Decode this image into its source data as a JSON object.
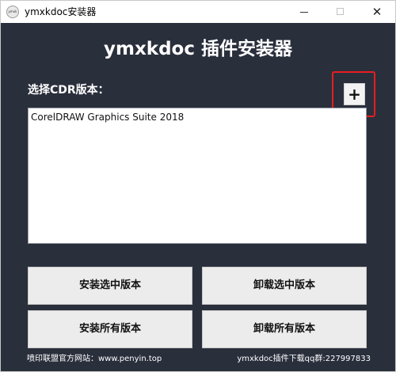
{
  "window": {
    "title": "ymxkdoc安装器",
    "icon_text": "ymxk",
    "minimize_icon": "minimize-icon",
    "maximize_icon": "maximize-icon",
    "close_icon": "close-icon",
    "close_glyph": "✕"
  },
  "main": {
    "title": "ymxkdoc 插件安装器",
    "select_label": "选择CDR版本：",
    "add_button_label": "+",
    "versions": [
      "CorelDRAW Graphics Suite 2018"
    ]
  },
  "actions": {
    "install_selected": "安装选中版本",
    "uninstall_selected": "卸载选中版本",
    "install_all": "安装所有版本",
    "uninstall_all": "卸载所有版本"
  },
  "footer": {
    "left_text": "喷印联盟官方网站：www.penyin.top",
    "right_text": "ymxkdoc插件下载qq群:227997833"
  },
  "colors": {
    "background": "#2a2f3c",
    "highlight": "#e81e1e"
  }
}
